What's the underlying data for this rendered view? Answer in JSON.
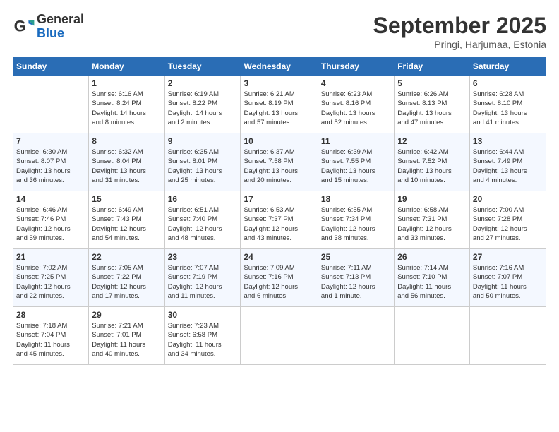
{
  "header": {
    "logo_general": "General",
    "logo_blue": "Blue",
    "month_title": "September 2025",
    "location": "Pringi, Harjumaa, Estonia"
  },
  "weekdays": [
    "Sunday",
    "Monday",
    "Tuesday",
    "Wednesday",
    "Thursday",
    "Friday",
    "Saturday"
  ],
  "weeks": [
    [
      {
        "day": "",
        "info": ""
      },
      {
        "day": "1",
        "info": "Sunrise: 6:16 AM\nSunset: 8:24 PM\nDaylight: 14 hours\nand 8 minutes."
      },
      {
        "day": "2",
        "info": "Sunrise: 6:19 AM\nSunset: 8:22 PM\nDaylight: 14 hours\nand 2 minutes."
      },
      {
        "day": "3",
        "info": "Sunrise: 6:21 AM\nSunset: 8:19 PM\nDaylight: 13 hours\nand 57 minutes."
      },
      {
        "day": "4",
        "info": "Sunrise: 6:23 AM\nSunset: 8:16 PM\nDaylight: 13 hours\nand 52 minutes."
      },
      {
        "day": "5",
        "info": "Sunrise: 6:26 AM\nSunset: 8:13 PM\nDaylight: 13 hours\nand 47 minutes."
      },
      {
        "day": "6",
        "info": "Sunrise: 6:28 AM\nSunset: 8:10 PM\nDaylight: 13 hours\nand 41 minutes."
      }
    ],
    [
      {
        "day": "7",
        "info": "Sunrise: 6:30 AM\nSunset: 8:07 PM\nDaylight: 13 hours\nand 36 minutes."
      },
      {
        "day": "8",
        "info": "Sunrise: 6:32 AM\nSunset: 8:04 PM\nDaylight: 13 hours\nand 31 minutes."
      },
      {
        "day": "9",
        "info": "Sunrise: 6:35 AM\nSunset: 8:01 PM\nDaylight: 13 hours\nand 25 minutes."
      },
      {
        "day": "10",
        "info": "Sunrise: 6:37 AM\nSunset: 7:58 PM\nDaylight: 13 hours\nand 20 minutes."
      },
      {
        "day": "11",
        "info": "Sunrise: 6:39 AM\nSunset: 7:55 PM\nDaylight: 13 hours\nand 15 minutes."
      },
      {
        "day": "12",
        "info": "Sunrise: 6:42 AM\nSunset: 7:52 PM\nDaylight: 13 hours\nand 10 minutes."
      },
      {
        "day": "13",
        "info": "Sunrise: 6:44 AM\nSunset: 7:49 PM\nDaylight: 13 hours\nand 4 minutes."
      }
    ],
    [
      {
        "day": "14",
        "info": "Sunrise: 6:46 AM\nSunset: 7:46 PM\nDaylight: 12 hours\nand 59 minutes."
      },
      {
        "day": "15",
        "info": "Sunrise: 6:49 AM\nSunset: 7:43 PM\nDaylight: 12 hours\nand 54 minutes."
      },
      {
        "day": "16",
        "info": "Sunrise: 6:51 AM\nSunset: 7:40 PM\nDaylight: 12 hours\nand 48 minutes."
      },
      {
        "day": "17",
        "info": "Sunrise: 6:53 AM\nSunset: 7:37 PM\nDaylight: 12 hours\nand 43 minutes."
      },
      {
        "day": "18",
        "info": "Sunrise: 6:55 AM\nSunset: 7:34 PM\nDaylight: 12 hours\nand 38 minutes."
      },
      {
        "day": "19",
        "info": "Sunrise: 6:58 AM\nSunset: 7:31 PM\nDaylight: 12 hours\nand 33 minutes."
      },
      {
        "day": "20",
        "info": "Sunrise: 7:00 AM\nSunset: 7:28 PM\nDaylight: 12 hours\nand 27 minutes."
      }
    ],
    [
      {
        "day": "21",
        "info": "Sunrise: 7:02 AM\nSunset: 7:25 PM\nDaylight: 12 hours\nand 22 minutes."
      },
      {
        "day": "22",
        "info": "Sunrise: 7:05 AM\nSunset: 7:22 PM\nDaylight: 12 hours\nand 17 minutes."
      },
      {
        "day": "23",
        "info": "Sunrise: 7:07 AM\nSunset: 7:19 PM\nDaylight: 12 hours\nand 11 minutes."
      },
      {
        "day": "24",
        "info": "Sunrise: 7:09 AM\nSunset: 7:16 PM\nDaylight: 12 hours\nand 6 minutes."
      },
      {
        "day": "25",
        "info": "Sunrise: 7:11 AM\nSunset: 7:13 PM\nDaylight: 12 hours\nand 1 minute."
      },
      {
        "day": "26",
        "info": "Sunrise: 7:14 AM\nSunset: 7:10 PM\nDaylight: 11 hours\nand 56 minutes."
      },
      {
        "day": "27",
        "info": "Sunrise: 7:16 AM\nSunset: 7:07 PM\nDaylight: 11 hours\nand 50 minutes."
      }
    ],
    [
      {
        "day": "28",
        "info": "Sunrise: 7:18 AM\nSunset: 7:04 PM\nDaylight: 11 hours\nand 45 minutes."
      },
      {
        "day": "29",
        "info": "Sunrise: 7:21 AM\nSunset: 7:01 PM\nDaylight: 11 hours\nand 40 minutes."
      },
      {
        "day": "30",
        "info": "Sunrise: 7:23 AM\nSunset: 6:58 PM\nDaylight: 11 hours\nand 34 minutes."
      },
      {
        "day": "",
        "info": ""
      },
      {
        "day": "",
        "info": ""
      },
      {
        "day": "",
        "info": ""
      },
      {
        "day": "",
        "info": ""
      }
    ]
  ]
}
